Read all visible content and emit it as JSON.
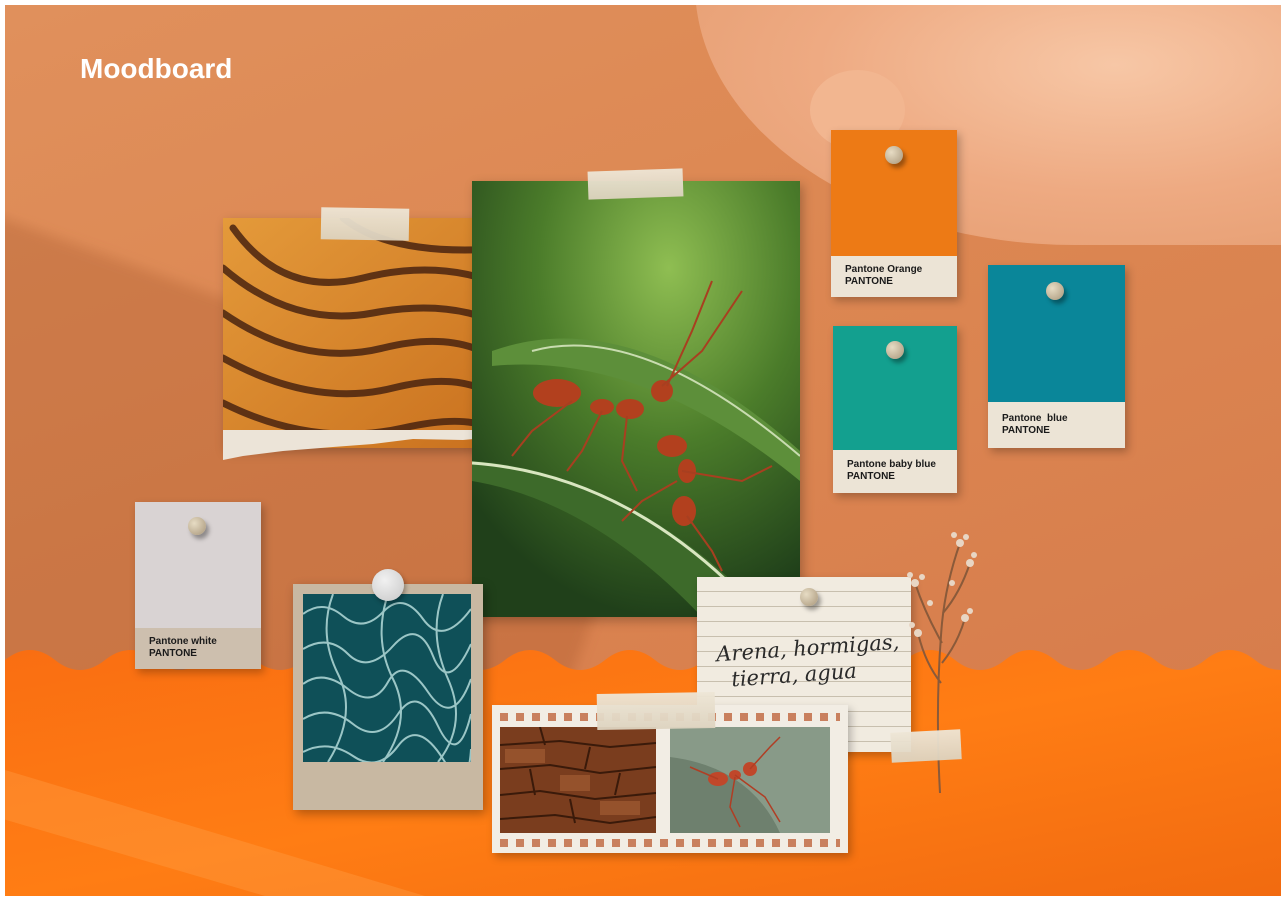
{
  "title": "Moodboard",
  "swatches": [
    {
      "name": "Pantone Orange",
      "brand": "PANTONE",
      "color": "#ed7a15"
    },
    {
      "name": "Pantone baby blue",
      "brand": "PANTONE",
      "color": "#13a08f"
    },
    {
      "name": "Pantone  blue",
      "brand": "PANTONE",
      "color": "#0a8699"
    },
    {
      "name": "Pantone white",
      "brand": "PANTONE",
      "color": "#d9d3d3"
    }
  ],
  "note": {
    "text": "Arena, hormigas,\n  tierra, agua"
  },
  "colors": {
    "background": "#dc8752",
    "wave_orange": "#ff7a10",
    "tape": "#e7dfcf"
  },
  "images": {
    "sand": "sand-dunes-photo",
    "ants": "ants-on-leaf-photo",
    "water": "water-caustics-photo",
    "rock": "rock-texture-photo",
    "ant_closeup": "ant-closeup-photo",
    "flower": "dried-flower"
  }
}
